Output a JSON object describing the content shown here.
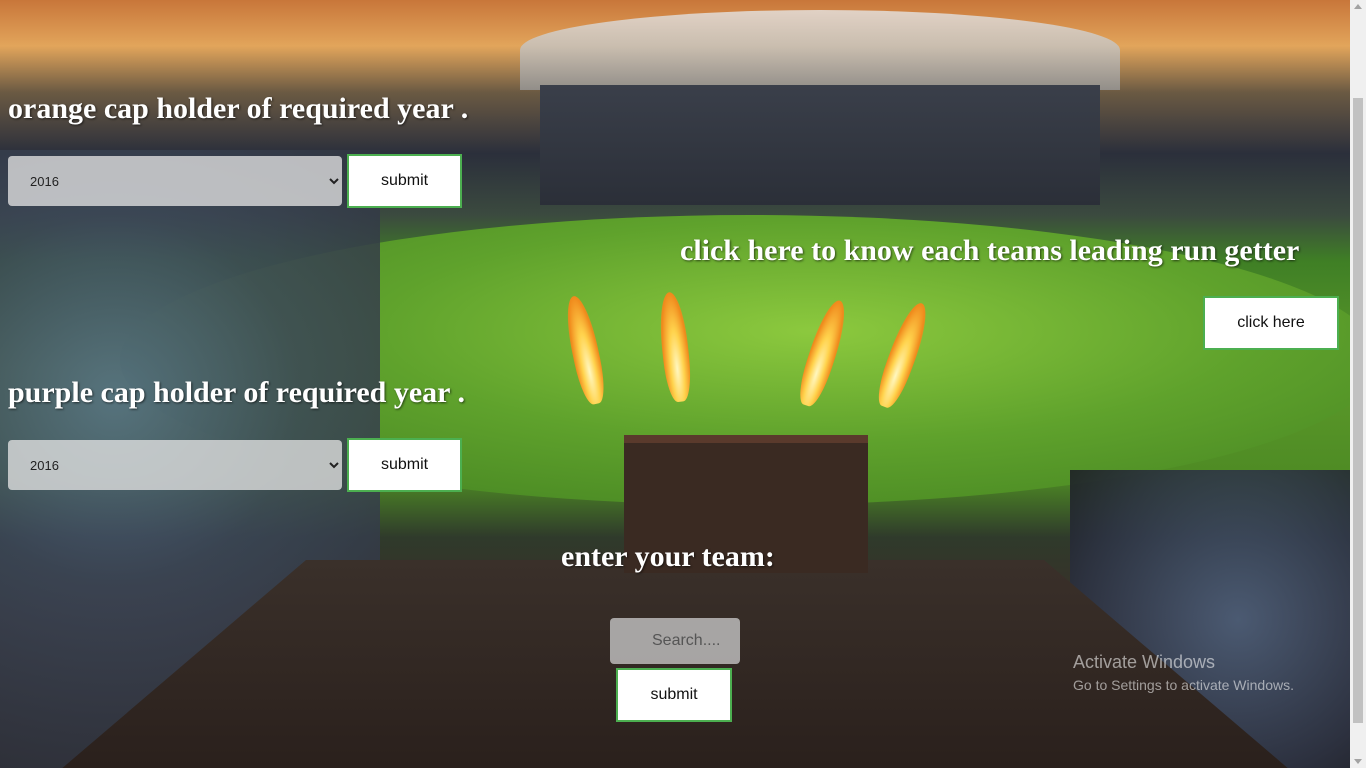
{
  "orange_section": {
    "heading": "orange cap holder of required year .",
    "selected_year": "2016",
    "submit_label": "submit"
  },
  "purple_section": {
    "heading": "purple cap holder of required year .",
    "selected_year": "2016",
    "submit_label": "submit"
  },
  "teams_section": {
    "heading": "click here to know each teams leading run getter",
    "button_label": "click here"
  },
  "team_search": {
    "heading": "enter your team:",
    "placeholder": "Search....",
    "submit_label": "submit"
  },
  "windows_watermark": {
    "title": "Activate Windows",
    "subtitle": "Go to Settings to activate Windows."
  },
  "background": "cricket-stadium-image"
}
